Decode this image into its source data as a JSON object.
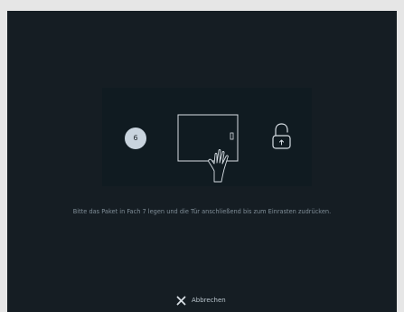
{
  "compartment": {
    "badge_number": "6"
  },
  "instruction_text": "Bitte das Paket in Fach 7 legen und die Tür anschließend bis zum Einrasten zudrücken.",
  "cancel": {
    "label": "Abbrechen",
    "icon": "close-icon"
  },
  "colors": {
    "screen_background": "#151d23",
    "panel_background": "#101b21",
    "badge_fill": "#c9d4de",
    "line_color": "#d7dee4",
    "instruction_color": "#7f8d97"
  },
  "icons": [
    "door-push-hand-icon",
    "unlocked-padlock-icon",
    "close-icon"
  ]
}
